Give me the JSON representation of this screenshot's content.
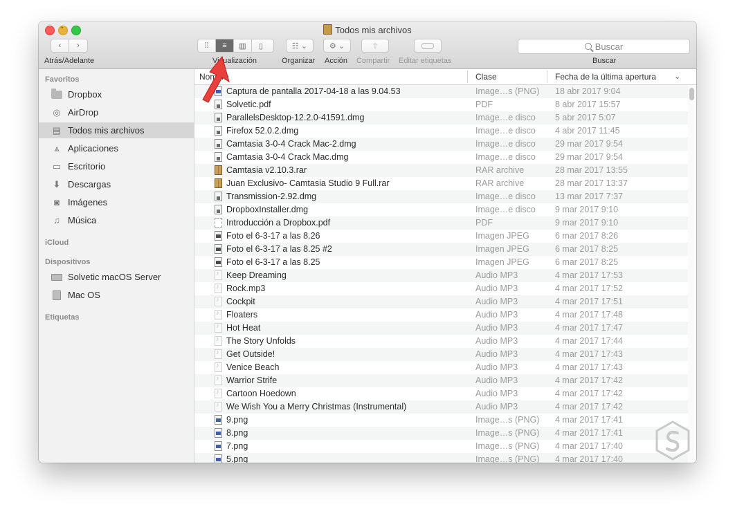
{
  "window": {
    "title": "Todos mis archivos"
  },
  "toolbar": {
    "back_forward_label": "Atrás/Adelante",
    "view_label": "Visualización",
    "arrange_label": "Organizar",
    "action_label": "Acción",
    "share_label": "Compartir",
    "tags_label": "Editar etiquetas",
    "search_placeholder": "Buscar",
    "search_label": "Buscar",
    "view_modes": [
      "icons",
      "list",
      "columns",
      "cover-flow"
    ],
    "active_view": "list"
  },
  "sidebar": {
    "sections": [
      {
        "header": "Favoritos"
      },
      {
        "header": "iCloud"
      },
      {
        "header": "Dispositivos"
      },
      {
        "header": "Etiquetas"
      }
    ],
    "favorites": [
      {
        "label": "Dropbox",
        "icon": "folder-icon"
      },
      {
        "label": "AirDrop",
        "icon": "airdrop-icon"
      },
      {
        "label": "Todos mis archivos",
        "icon": "all-files-icon",
        "selected": true
      },
      {
        "label": "Aplicaciones",
        "icon": "applications-icon"
      },
      {
        "label": "Escritorio",
        "icon": "desktop-icon"
      },
      {
        "label": "Descargas",
        "icon": "downloads-icon"
      },
      {
        "label": "Imágenes",
        "icon": "pictures-icon"
      },
      {
        "label": "Música",
        "icon": "music-icon"
      }
    ],
    "devices": [
      {
        "label": "Solvetic macOS Server",
        "icon": "server-icon"
      },
      {
        "label": "Mac OS",
        "icon": "disk-icon"
      }
    ]
  },
  "columns": {
    "name": "Nombre",
    "kind": "Clase",
    "date": "Fecha de la última apertura"
  },
  "files": [
    {
      "name": "Captura de pantalla 2017-04-18 a las 9.04.53",
      "kind": "Image…s (PNG)",
      "date": "18 abr 2017 9:04",
      "icon": "png"
    },
    {
      "name": "Solvetic.pdf",
      "kind": "PDF",
      "date": "8 abr 2017 15:57",
      "icon": "doc"
    },
    {
      "name": "ParallelsDesktop-12.2.0-41591.dmg",
      "kind": "Image…e disco",
      "date": "5 abr 2017 5:07",
      "icon": "doc"
    },
    {
      "name": "Firefox 52.0.2.dmg",
      "kind": "Image…e disco",
      "date": "4 abr 2017 11:45",
      "icon": "doc"
    },
    {
      "name": "Camtasia 3-0-4 Crack Mac-2.dmg",
      "kind": "Image…e disco",
      "date": "29 mar 2017 9:54",
      "icon": "doc"
    },
    {
      "name": "Camtasia 3-0-4 Crack Mac.dmg",
      "kind": "Image…e disco",
      "date": "29 mar 2017 9:54",
      "icon": "doc"
    },
    {
      "name": "Camtasia v2.10.3.rar",
      "kind": "RAR archive",
      "date": "28 mar 2017 13:55",
      "icon": "rar"
    },
    {
      "name": "Juan Exclusivo- Camtasia Studio 9 Full.rar",
      "kind": "RAR archive",
      "date": "28 mar 2017 13:37",
      "icon": "rar"
    },
    {
      "name": "Transmission-2.92.dmg",
      "kind": "Image…e disco",
      "date": "13 mar 2017 7:37",
      "icon": "doc"
    },
    {
      "name": "DropboxInstaller.dmg",
      "kind": "Image…e disco",
      "date": "9 mar 2017 9:10",
      "icon": "doc"
    },
    {
      "name": "Introducción a Dropbox.pdf",
      "kind": "PDF",
      "date": "9 mar 2017 9:10",
      "icon": "dotted"
    },
    {
      "name": "Foto el 6-3-17 a las 8.26",
      "kind": "Imagen JPEG",
      "date": "6 mar 2017 8:26",
      "icon": "img"
    },
    {
      "name": "Foto el 6-3-17 a las 8.25 #2",
      "kind": "Imagen JPEG",
      "date": "6 mar 2017 8:25",
      "icon": "img"
    },
    {
      "name": "Foto el 6-3-17 a las 8.25",
      "kind": "Imagen JPEG",
      "date": "6 mar 2017 8:25",
      "icon": "img"
    },
    {
      "name": "Keep Dreaming",
      "kind": "Audio MP3",
      "date": "4 mar 2017 17:53",
      "icon": "audio"
    },
    {
      "name": "Rock.mp3",
      "kind": "Audio MP3",
      "date": "4 mar 2017 17:52",
      "icon": "audio"
    },
    {
      "name": "Cockpit",
      "kind": "Audio MP3",
      "date": "4 mar 2017 17:51",
      "icon": "audio"
    },
    {
      "name": "Floaters",
      "kind": "Audio MP3",
      "date": "4 mar 2017 17:48",
      "icon": "audio"
    },
    {
      "name": "Hot Heat",
      "kind": "Audio MP3",
      "date": "4 mar 2017 17:47",
      "icon": "audio"
    },
    {
      "name": "The Story Unfolds",
      "kind": "Audio MP3",
      "date": "4 mar 2017 17:44",
      "icon": "audio"
    },
    {
      "name": "Get Outside!",
      "kind": "Audio MP3",
      "date": "4 mar 2017 17:43",
      "icon": "audio"
    },
    {
      "name": "Venice Beach",
      "kind": "Audio MP3",
      "date": "4 mar 2017 17:43",
      "icon": "audio"
    },
    {
      "name": "Warrior Strife",
      "kind": "Audio MP3",
      "date": "4 mar 2017 17:42",
      "icon": "audio"
    },
    {
      "name": "Cartoon Hoedown",
      "kind": "Audio MP3",
      "date": "4 mar 2017 17:42",
      "icon": "audio"
    },
    {
      "name": "We Wish You a Merry Christmas (Instrumental)",
      "kind": "Audio MP3",
      "date": "4 mar 2017 17:42",
      "icon": "audio"
    },
    {
      "name": "9.png",
      "kind": "Image…s (PNG)",
      "date": "4 mar 2017 17:41",
      "icon": "png"
    },
    {
      "name": "8.png",
      "kind": "Image…s (PNG)",
      "date": "4 mar 2017 17:41",
      "icon": "png"
    },
    {
      "name": "7.png",
      "kind": "Image…s (PNG)",
      "date": "4 mar 2017 17:40",
      "icon": "png"
    },
    {
      "name": "5.png",
      "kind": "Image…s (PNG)",
      "date": "4 mar 2017 17:40",
      "icon": "png"
    }
  ],
  "colors": {
    "accent_arrow": "#e8403a",
    "selected_sidebar": "#d6d6d6",
    "watermark": "#c9c9c9"
  }
}
